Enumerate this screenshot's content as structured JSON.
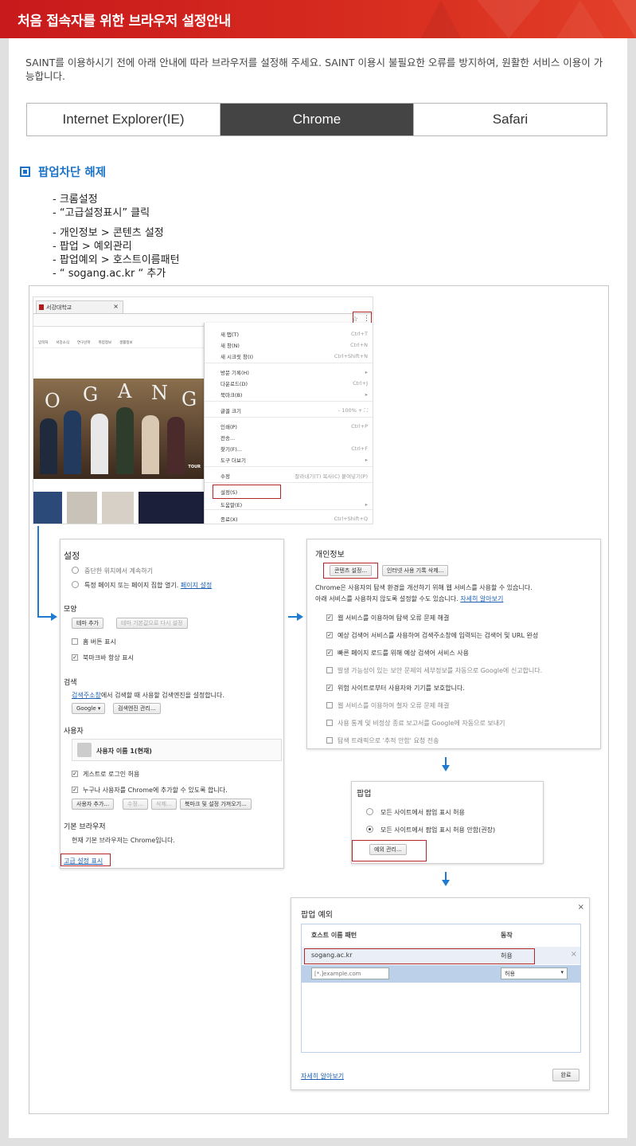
{
  "header": {
    "title": "처음 접속자를 위한 브라우저 설정안내"
  },
  "intro": {
    "text": "SAINT를 이용하시기 전에 아래 안내에 따라 브라우저를 설정해 주세요. SAINT 이용시 불필요한 오류를 방지하여, 원활한 서비스 이용이 가능합니다."
  },
  "tabs": [
    {
      "label": "Internet Explorer(IE)",
      "active": false
    },
    {
      "label": "Chrome",
      "active": true
    },
    {
      "label": "Safari",
      "active": false
    }
  ],
  "section": {
    "title": "팝업차단 해제"
  },
  "steps": [
    "- 크롬설정",
    "- “고급설정표시” 클릭",
    "- 개인정보 > 콘텐츠 설정",
    "- 팝업 > 예외관리",
    "- 팝업예외 > 호스트이름패턴",
    "- “ sogang.ac.kr “ 추가"
  ],
  "browser": {
    "tab_label": "서강대학교",
    "tab_close": "×",
    "site_nav": [
      "입학처",
      "서강소식",
      "연구산학",
      "취업정보",
      "생활정보"
    ],
    "photo_letters": [
      "O",
      "G",
      "A",
      "N",
      "G"
    ],
    "photo_tour": "TOUR"
  },
  "chrome_menu": {
    "items": [
      {
        "label": "새 탭(T)",
        "shortcut": "Ctrl+T"
      },
      {
        "label": "새 창(N)",
        "shortcut": "Ctrl+N"
      },
      {
        "label": "새 시크릿 창(I)",
        "shortcut": "Ctrl+Shift+N"
      },
      {
        "label": "방문 기록(H)",
        "shortcut": "▸"
      },
      {
        "label": "다운로드(D)",
        "shortcut": "Ctrl+J"
      },
      {
        "label": "북마크(B)",
        "shortcut": "▸"
      },
      {
        "label": "글꼴 크기",
        "shortcut": "-   100%   +    ⛶"
      },
      {
        "label": "인쇄(P)",
        "shortcut": "Ctrl+P"
      },
      {
        "label": "전송...",
        "shortcut": ""
      },
      {
        "label": "찾기(F)...",
        "shortcut": "Ctrl+F"
      },
      {
        "label": "도구 더보기",
        "shortcut": "▸"
      },
      {
        "label": "수정",
        "shortcut": "잘라내기(T)   복사(C)   붙여넣기(P)"
      },
      {
        "label": "설정(S)",
        "shortcut": ""
      },
      {
        "label": "도움말(E)",
        "shortcut": "▸"
      },
      {
        "label": "종료(X)",
        "shortcut": "Ctrl+Shift+Q"
      }
    ]
  },
  "settings": {
    "title": "설정",
    "startup_1": "중단한 위치에서 계속하기",
    "startup_2": "특정 페이지 또는 페이지 집합 열기.",
    "startup_link": "페이지 설정",
    "appearance": "모양",
    "theme_btn": "테마 추가",
    "theme_reset_btn": "테마 기본값으로 다시 설정",
    "home_btn": "홈 버튼 표시",
    "bookmark_bar": "북마크바 항상 표시",
    "search": "검색",
    "search_desc_link": "검색주소창",
    "search_desc": "에서 검색할 때 사용할 검색엔진을 설정합니다.",
    "search_engine": "Google ▾",
    "search_manage": "검색엔진 관리...",
    "users": "사용자",
    "user_name": "사용자 이름 1(현재)",
    "guest": "게스트로 로그인 허용",
    "anyone": "누구나 사용자를 Chrome에 추가할 수 있도록 합니다.",
    "add_user": "사용자 추가...",
    "edit_user": "수정...",
    "delete_user": "삭제...",
    "import": "북마크 및 설정 가져오기...",
    "default_browser": "기본 브라우저",
    "default_desc": "현재 기본 브라우저는 Chrome입니다.",
    "advanced_link": "고급 설정 표시"
  },
  "privacy": {
    "title": "개인정보",
    "content_btn": "콘텐츠 설정...",
    "clear_btn": "인터넷 사용 기록 삭제...",
    "desc_1": "Chrome은 사용자의 탐색 환경을 개선하기 위해 웹 서비스를 사용할 수 있습니다.",
    "desc_2": "아래 서비스를 사용하지 않도록 설정할 수도 있습니다.",
    "desc_link": "자세히 알아보기",
    "options": [
      {
        "label": "웹 서비스를 이용하여 탐색 오류 문제 해결",
        "checked": true
      },
      {
        "label": "예상 검색어 서비스를 사용하여 검색주소창에 입력되는 검색어 및 URL 완성",
        "checked": true
      },
      {
        "label": "빠른 페이지 로드를 위해 예상 검색어 서비스 사용",
        "checked": true
      },
      {
        "label": "발생 가능성이 있는 보안 문제의 세부정보를 자동으로 Google에 신고합니다.",
        "checked": false
      },
      {
        "label": "위험 사이트로부터 사용자와 기기를 보호합니다.",
        "checked": true
      },
      {
        "label": "웹 서비스를 이용하여 철자 오류 문제 해결",
        "checked": false
      },
      {
        "label": "사용 통계 및 비정상 종료 보고서를 Google에 자동으로 보내기",
        "checked": false
      },
      {
        "label": "탐색 트래픽으로 '추적 안함' 요청 전송",
        "checked": false
      }
    ]
  },
  "popup": {
    "title": "팝업",
    "allow_all": "모든 사이트에서 팝업 표시 허용",
    "block_all": "모든 사이트에서 팝업 표시 허용 안함(권장)",
    "exceptions_btn": "예외 관리..."
  },
  "popup_exceptions": {
    "title": "팝업 예외",
    "close": "×",
    "col_host": "호스트 이름 패턴",
    "col_action": "동작",
    "row_host": "sogang.ac.kr",
    "row_action": "허용",
    "row_delete": "×",
    "input_placeholder": "[*.]example.com",
    "input_action": "허용",
    "learn_more": "자세히 알아보기",
    "done_btn": "완료"
  },
  "colors": {
    "accent_red": "#c8191c",
    "accent_blue": "#1a73c8",
    "tab_active": "#444444",
    "highlight_box": "#b3272b"
  }
}
